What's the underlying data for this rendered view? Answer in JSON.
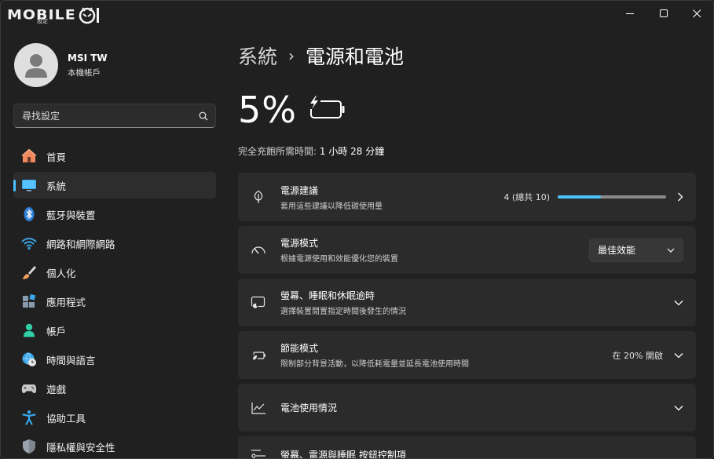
{
  "titlebar": {
    "logo_text": "MOBILE",
    "logo_sub": "設定",
    "minimize_icon": "minimize-icon",
    "maximize_icon": "maximize-icon",
    "close_icon": "close-icon"
  },
  "profile": {
    "name": "MSI TW",
    "account_type": "本機帳戶"
  },
  "search": {
    "placeholder": "尋找設定"
  },
  "sidebar": {
    "items": [
      {
        "label": "首頁",
        "icon": "home-icon",
        "active": false
      },
      {
        "label": "系統",
        "icon": "system-icon",
        "active": true
      },
      {
        "label": "藍牙與裝置",
        "icon": "bluetooth-icon",
        "active": false
      },
      {
        "label": "網路和網際網路",
        "icon": "wifi-icon",
        "active": false
      },
      {
        "label": "個人化",
        "icon": "brush-icon",
        "active": false
      },
      {
        "label": "應用程式",
        "icon": "apps-icon",
        "active": false
      },
      {
        "label": "帳戶",
        "icon": "person-icon",
        "active": false
      },
      {
        "label": "時間與語言",
        "icon": "globe-clock-icon",
        "active": false
      },
      {
        "label": "遊戲",
        "icon": "gamepad-icon",
        "active": false
      },
      {
        "label": "協助工具",
        "icon": "accessibility-icon",
        "active": false
      },
      {
        "label": "隱私權與安全性",
        "icon": "shield-icon",
        "active": false
      }
    ]
  },
  "breadcrumb": {
    "parent": "系統",
    "separator": "›",
    "current": "電源和電池"
  },
  "battery": {
    "percent_text": "5%",
    "charge_label": "完全充飽所需時間:",
    "charge_value": "1 小時 28 分鐘",
    "icon": "battery-charging-icon"
  },
  "cards": {
    "recommendations": {
      "title": "電源建議",
      "subtitle": "套用這些建議以降低碳使用量",
      "value": "4 (總共 10)",
      "progress_fraction": 0.4,
      "icon": "leaf-icon"
    },
    "power_mode": {
      "title": "電源模式",
      "subtitle": "根據電源使用和效能優化您的裝置",
      "selected": "最佳效能",
      "icon": "gauge-icon"
    },
    "screen_sleep": {
      "title": "螢幕、睡眠和休眠逾時",
      "subtitle": "選擇裝置閒置指定時間後發生的情況",
      "icon": "screen-sleep-icon"
    },
    "energy_saver": {
      "title": "節能模式",
      "subtitle": "限制部分背景活動，以降低耗電量並延長電池使用時間",
      "status": "在 20% 開啟",
      "icon": "energy-saver-icon"
    },
    "battery_usage": {
      "title": "電池使用情況",
      "icon": "chart-line-icon"
    },
    "lid_buttons": {
      "title": "螢幕、電源與睡眠 按鈕控制項",
      "icon": "controls-icon"
    }
  },
  "colors": {
    "accent": "#4cc2ff",
    "background": "#202020",
    "card": "#2b2b2b"
  }
}
